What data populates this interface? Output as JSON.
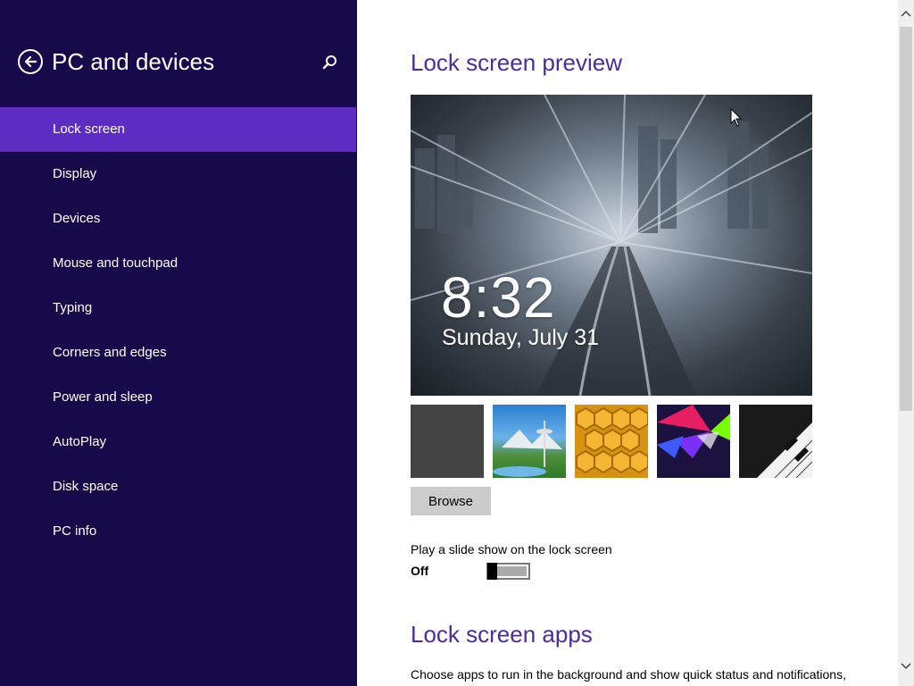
{
  "sidebar": {
    "title": "PC and devices",
    "back_icon": "back-arrow-icon",
    "search_icon": "search-icon",
    "items": [
      {
        "label": "Lock screen",
        "selected": true
      },
      {
        "label": "Display"
      },
      {
        "label": "Devices"
      },
      {
        "label": "Mouse and touchpad"
      },
      {
        "label": "Typing"
      },
      {
        "label": "Corners and edges"
      },
      {
        "label": "Power and sleep"
      },
      {
        "label": "AutoPlay"
      },
      {
        "label": "Disk space"
      },
      {
        "label": "PC info"
      }
    ],
    "colors": {
      "background": "#180a4a",
      "selected": "#5d2cc2"
    }
  },
  "main": {
    "preview_title": "Lock screen preview",
    "preview": {
      "time": "8:32",
      "date": "Sunday, July 31"
    },
    "thumbnails": [
      "gray-blank-thumbnail",
      "space-needle-thumbnail",
      "honeycomb-thumbnail",
      "geometric-colors-thumbnail",
      "piano-keys-thumbnail"
    ],
    "browse_label": "Browse",
    "slideshow": {
      "label": "Play a slide show on the lock screen",
      "state": "Off"
    },
    "apps_title": "Lock screen apps",
    "apps_description": "Choose apps to run in the background and show quick status and notifications,",
    "accent_color": "#4b2c9e"
  }
}
